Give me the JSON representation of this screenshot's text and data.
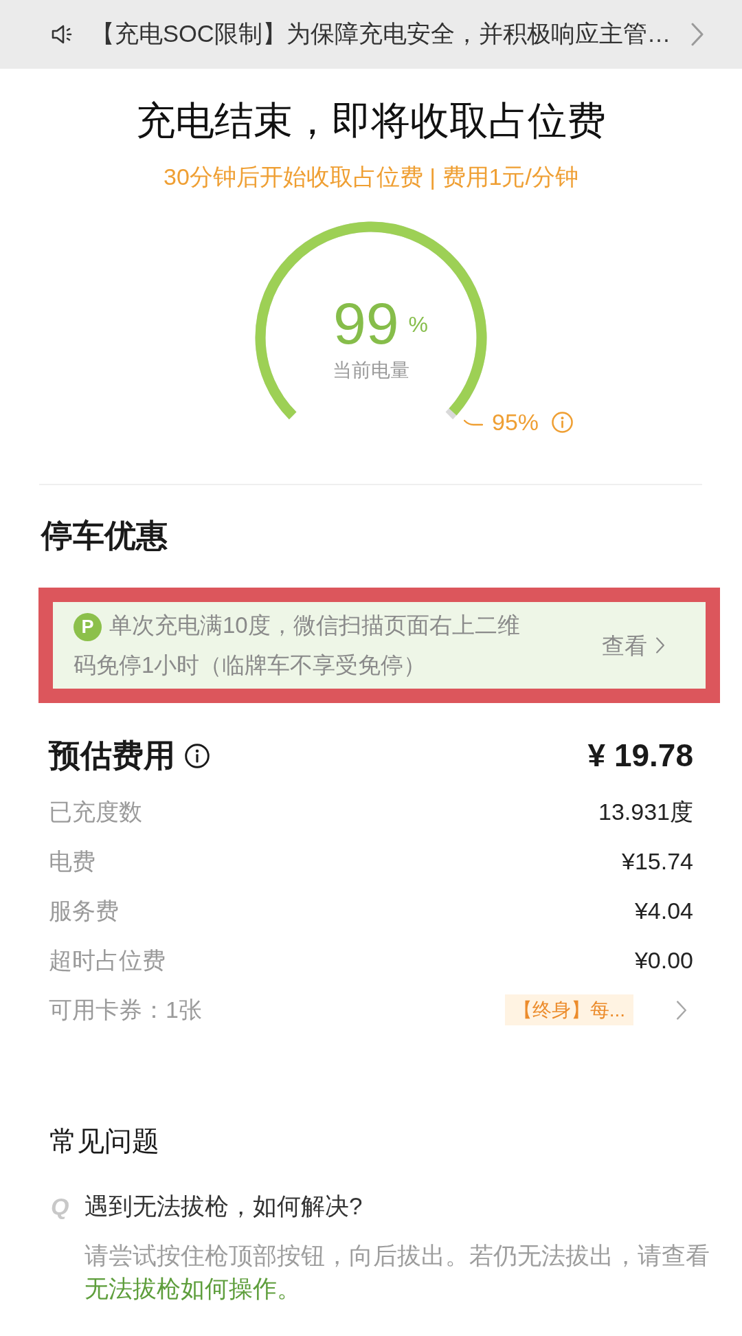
{
  "notice": {
    "text": "【充电SOC限制】为保障充电安全，并积极响应主管…"
  },
  "status": {
    "title": "充电结束，即将收取占位费",
    "subtitle": "30分钟后开始收取占位费 | 费用1元/分钟"
  },
  "gauge": {
    "value": "99",
    "unit": "%",
    "label": "当前电量",
    "level": 0.99,
    "limit": "95%"
  },
  "parking": {
    "heading": "停车优惠",
    "highlighted": true,
    "badge": "P",
    "offer": "单次充电满10度，微信扫描页面右上二维码免停1小时（临牌车不享受免停）",
    "action": "查看"
  },
  "fees": {
    "heading": "预估费用",
    "total": "¥ 19.78",
    "rows": [
      {
        "kind": "amount",
        "label": "已充度数",
        "value": "13.931度"
      },
      {
        "kind": "amount",
        "label": "电费",
        "value": "¥15.74"
      },
      {
        "kind": "amount",
        "label": "服务费",
        "value": "¥4.04"
      },
      {
        "kind": "amount",
        "label": "超时占位费",
        "value": "¥0.00"
      },
      {
        "kind": "coupon",
        "label": "可用卡券：1张",
        "tag": "【终身】每..."
      }
    ]
  },
  "faq": {
    "heading": "常见问题",
    "items": [
      {
        "marker": "Q",
        "question": "遇到无法拔枪，如何解决?",
        "answer": "请尝试按住枪顶部按钮，向后拔出。若仍无法拔出，请查看",
        "link": "无法拔枪如何操作。"
      }
    ]
  }
}
